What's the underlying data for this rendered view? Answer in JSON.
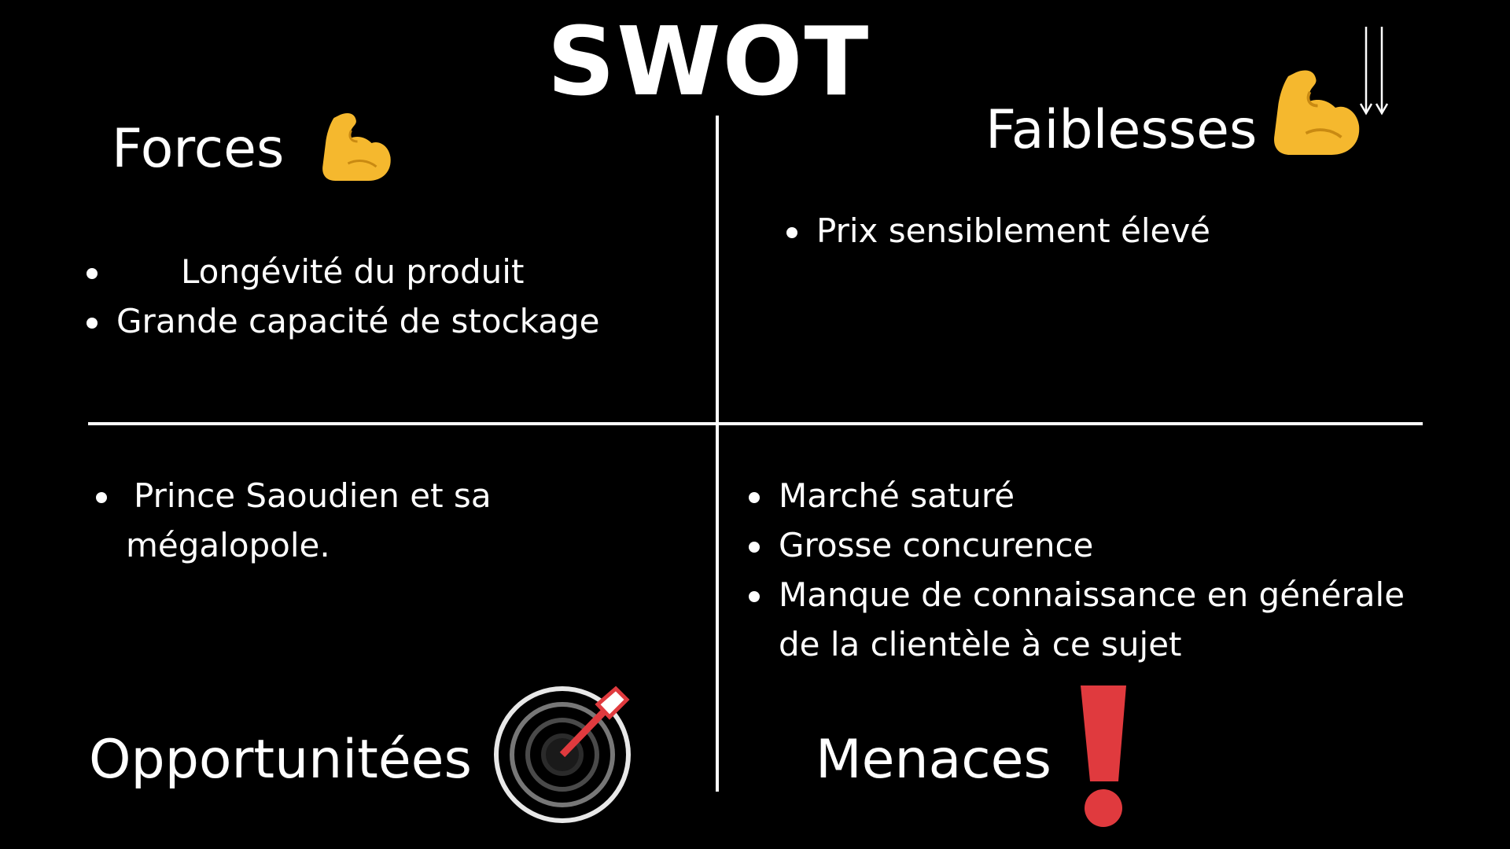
{
  "title": "SWOT",
  "quadrants": {
    "forces": {
      "heading": "Forces",
      "icon": "flexed-biceps-icon",
      "items": [
        "Longévité du produit",
        "Grande capacité de stockage"
      ]
    },
    "faiblesses": {
      "heading": "Faiblesses",
      "icon": "flexed-biceps-icon",
      "icon2": "down-arrows-icon",
      "items": [
        "Prix sensiblement élevé"
      ]
    },
    "opportunites": {
      "heading": "Opportunitées",
      "icon": "bullseye-target-icon",
      "items": [
        "Prince Saoudien et sa mégalopole."
      ]
    },
    "menaces": {
      "heading": "Menaces",
      "icon": "red-exclamation-icon",
      "items": [
        "Marché saturé",
        "Grosse concurence",
        "Manque de connaissance en générale de la clientèle à ce sujet"
      ]
    }
  },
  "colors": {
    "background": "#000000",
    "text": "#ffffff",
    "emoji_yellow": "#f5b82e",
    "exclamation_red": "#e03a3e"
  }
}
